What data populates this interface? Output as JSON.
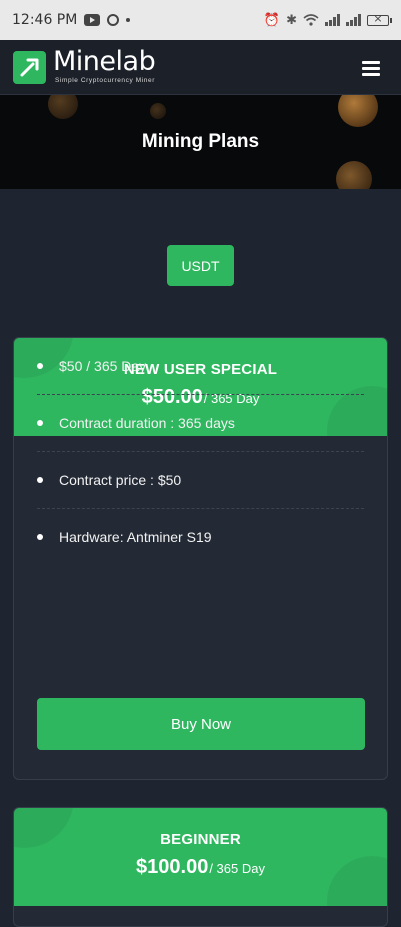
{
  "status_bar": {
    "time": "12:46 PM",
    "indicators": [
      "youtube-icon",
      "whatsapp-icon",
      "dot-icon",
      "alarm-icon",
      "bluetooth-icon",
      "wifi-icon",
      "signal-icon",
      "battery-icon"
    ]
  },
  "nav": {
    "brand_name": "Minelab",
    "brand_tagline": "Simple Cryptocurrency Miner",
    "menu_icon": "hamburger-menu-icon"
  },
  "hero": {
    "title": "Mining Plans"
  },
  "currency": {
    "selected": "USDT"
  },
  "plans": [
    {
      "name": "NEW USER SPECIAL",
      "price": "$50.00",
      "period": "/ 365 Day",
      "features": [
        "$50 / 365 Day",
        "Contract duration : 365 days",
        "Contract price : $50",
        "Hardware: Antminer S19"
      ],
      "button": "Buy Now"
    },
    {
      "name": "BEGINNER",
      "price": "$100.00",
      "period": "/ 365 Day"
    }
  ],
  "colors": {
    "accent": "#2fb760",
    "background": "#1f2530",
    "card": "#232a35",
    "navbar": "#1b2029",
    "hero": "#08090b"
  }
}
